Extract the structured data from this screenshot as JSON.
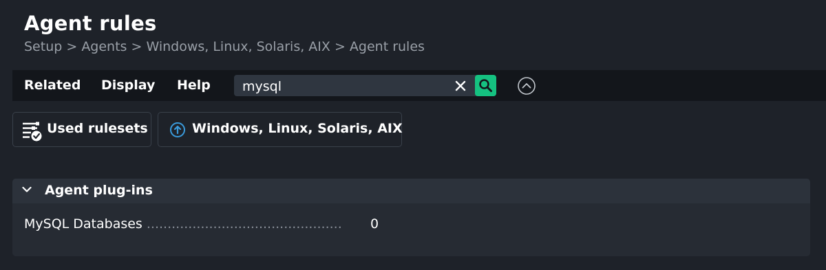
{
  "page": {
    "title": "Agent rules",
    "breadcrumb": [
      "Setup",
      "Agents",
      "Windows, Linux, Solaris, AIX",
      "Agent rules"
    ],
    "breadcrumb_sep": " > "
  },
  "menubar": {
    "items": [
      "Related",
      "Display",
      "Help"
    ],
    "search_value": "mysql"
  },
  "buttons": {
    "used_rulesets": "Used rulesets",
    "parent_folder": "Windows, Linux, Solaris, AIX"
  },
  "section": {
    "title": "Agent plug-ins",
    "rules": [
      {
        "name": "MySQL Databases",
        "dots": "...............................................",
        "count": "0"
      }
    ]
  },
  "colors": {
    "background": "#1e2229",
    "menubar": "#13161b",
    "accent_green": "#15c281",
    "accent_blue": "#3a9bdc",
    "muted_text": "#9aa0a8"
  }
}
